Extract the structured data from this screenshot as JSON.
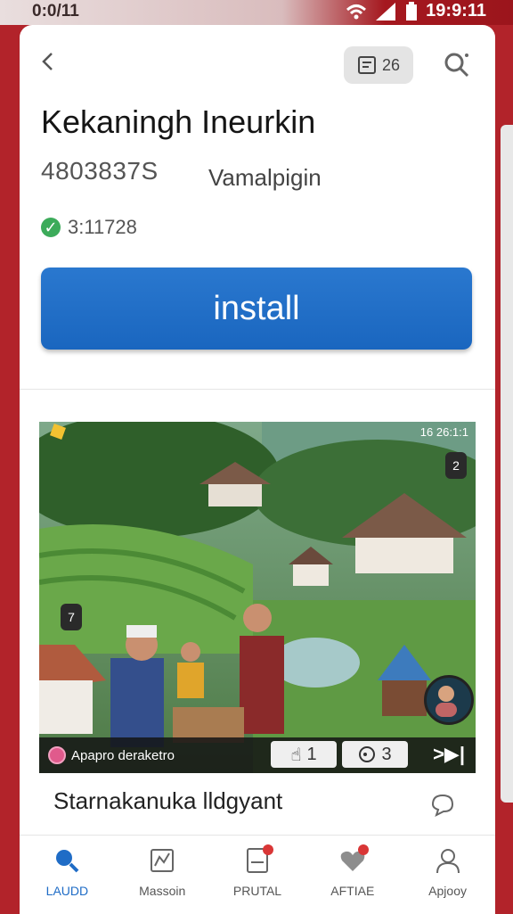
{
  "status": {
    "left_time": "0:0/11",
    "clock": "19:9:11"
  },
  "app": {
    "badge_label": "26",
    "title": "Kekaningh Ineurkin",
    "code": "4803837S",
    "developer": "Vamalpigin",
    "rating": "3:11728",
    "install_label": "install"
  },
  "media": {
    "channel_name": "Apapro deraketro",
    "like_count": "1",
    "view_count": "3",
    "overlay_left_chip": "7",
    "overlay_right_chip": "2",
    "status_text": "16 26:1:1"
  },
  "caption": "Starnakanuka lldgyant",
  "nav": {
    "items": [
      {
        "label": "LAUDD",
        "icon": "search-icon",
        "active": true
      },
      {
        "label": "Massoin",
        "icon": "chart-icon",
        "active": false
      },
      {
        "label": "PRUTAL",
        "icon": "document-icon",
        "active": false
      },
      {
        "label": "AFTIAE",
        "icon": "heart-icon",
        "active": false
      },
      {
        "label": "Apjooy",
        "icon": "person-icon",
        "active": false
      }
    ]
  },
  "colors": {
    "accent": "#1f6cc6",
    "brand": "#b2232a",
    "rating_green": "#3cab5a"
  }
}
